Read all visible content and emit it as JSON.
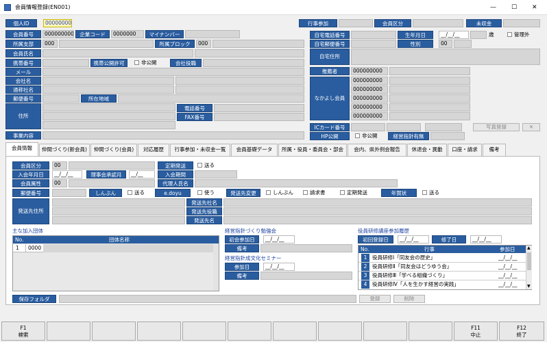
{
  "window": {
    "title": "会員情報登録(EN001)",
    "min": "—",
    "max": "☐",
    "close": "✕"
  },
  "top": {
    "kojin_id_label": "個人ID",
    "kojin_id": "000000000",
    "kaiin_bangou_label": "会員番号",
    "kaiin_bangou": "000000000",
    "kigyou_code_label": "企業コード",
    "kigyou_code": "0000000",
    "mynumber_label": "マイナンバー",
    "shozoku_shibu_label": "所属支部",
    "shozoku_shibu": "000",
    "shozoku_block_label": "所属ブロック",
    "shozoku_block": "000",
    "kaiin_shimei_label": "会員氏名",
    "keitai_label": "携帯番号",
    "keitai_kokai_label": "携帯公開許可",
    "hikokai": "非公開",
    "kaisha_yakushoku_label": "会社役職",
    "mail_label": "メール",
    "kaishamei_label": "会社名",
    "tsuushoumei_label": "通称社名",
    "yuubin_label": "郵便番号",
    "shozai_label": "所在地域",
    "denwa_label": "電話番号",
    "fax_label": "FAX番号",
    "juusho_label": "住所",
    "jigyou_label": "事業内容"
  },
  "right": {
    "gyouji_label": "行事参加",
    "kaiin_kubun_label": "会員区分",
    "mishuukin_label": "未収金",
    "jitaku_denwa_label": "自宅電話番号",
    "seinengappi_label": "生年月日",
    "seinengappi": "__/__/__",
    "sai": "歳",
    "kanrigai": "管理外",
    "jitaku_yuubin_label": "自宅郵便番号",
    "seibetsu_label": "性別",
    "seibetsu": "00",
    "jitaku_juusho_label": "自宅住所",
    "suisensha_label": "推薦者",
    "suisensha": "000000000",
    "nakayoshi_label": "なかよし会員",
    "nakayoshi": [
      "000000000",
      "000000000",
      "000000000",
      "000000000",
      "000000000"
    ],
    "ic_label": "ICカード番号",
    "photo_register": "写真登録",
    "photo_delete": "✕",
    "hp_label": "HP公開",
    "hp_hikokai": "非公開",
    "keiei_label": "経営指針有無"
  },
  "tabs": [
    "会員情報",
    "仲間づくり(新会員)",
    "仲間づくり(会員)",
    "対応履歴",
    "行事参加・未収金一覧",
    "会員基礎データ",
    "所属・役員・委員会・部会",
    "会内、県外例会報告",
    "休退会・異動",
    "口座・請求",
    "備考"
  ],
  "panel": {
    "kaiin_kubun_label": "会員区分",
    "kaiin_kubun": "00",
    "teiki_label": "定期発送",
    "okuru": "送る",
    "nyuukai_label": "入会年月日",
    "nyuukai": "__/__/__",
    "riji_label": "理事会承認月",
    "riji": "__/__",
    "nyuukai_kikan_label": "入会期間",
    "kaiin_zokusei_label": "会員属性",
    "kaiin_zokusei": "00",
    "dairinin_label": "代理人氏名",
    "yuubin_label": "郵便番号",
    "shinbun_label": "しんぶん",
    "shinbun_okuru": "送る",
    "edoyu_label": "e.doyu",
    "tsukau": "使う",
    "hassousaki_henkou_label": "発送先変更",
    "shinbun_chk": "しんぶん",
    "seikyuusho": "請求書",
    "teiki_hassou": "定期発送",
    "nengajou_label": "年賀状",
    "nengajou_okuru": "送る",
    "hassou_juusho_label": "発送先住所",
    "hassou_shamei_label": "発送先社名",
    "hassou_yakushoku_label": "発送先役職",
    "hassou_mei_label": "発送先名",
    "dantai_title": "主な加入団体",
    "dantai_no": "No.",
    "dantai_name_col": "団体名称",
    "dantai_rows": [
      {
        "no": "1",
        "code": "0000",
        "name": ""
      }
    ],
    "benkyoukai_title": "経営指針づくり勉強会",
    "shokai_label": "初会参加日",
    "shokai": "__/__/__",
    "bikou_label": "備考",
    "seminar_title": "経営指針成文化セミナー",
    "sanka_label": "参加日",
    "sanka": "__/__/__",
    "bikou2_label": "備考",
    "kenshuu_title": "役員研修講座参加履歴",
    "shokai_touroku_label": "初回登録日",
    "shokai_touroku": "__/__/__",
    "shuuryou_label": "修了日",
    "shuuryou": "__/__/__",
    "kenshuu_no": "No.",
    "kenshuu_gyouji": "行事",
    "kenshuu_sanka": "参加日",
    "kenshuu_rows": [
      {
        "no": "1",
        "name": "役員研修Ⅰ「同友会の歴史」",
        "date": "__/__/__"
      },
      {
        "no": "2",
        "name": "役員研修Ⅱ「同友会はどうゆう会」",
        "date": "__/__/__"
      },
      {
        "no": "3",
        "name": "役員研修Ⅲ「学べる組織づくり」",
        "date": "__/__/__"
      },
      {
        "no": "4",
        "name": "役員研修Ⅳ「人を生かす経営の実践」",
        "date": "__/__/__"
      }
    ],
    "hozon_label": "保存フォルダ",
    "touroku": "登録",
    "sakujo": "削除"
  },
  "fkeys": [
    {
      "k": "F1",
      "l": "検索"
    },
    {
      "k": "",
      "l": ""
    },
    {
      "k": "",
      "l": ""
    },
    {
      "k": "",
      "l": ""
    },
    {
      "k": "",
      "l": ""
    },
    {
      "k": "",
      "l": ""
    },
    {
      "k": "",
      "l": ""
    },
    {
      "k": "",
      "l": ""
    },
    {
      "k": "",
      "l": ""
    },
    {
      "k": "",
      "l": ""
    },
    {
      "k": "F11",
      "l": "中止"
    },
    {
      "k": "F12",
      "l": "終了"
    }
  ],
  "colors": {
    "label_bg": "#2a5d9f",
    "field_bg": "#d6d6d6",
    "section_title": "#1a3fa0"
  }
}
